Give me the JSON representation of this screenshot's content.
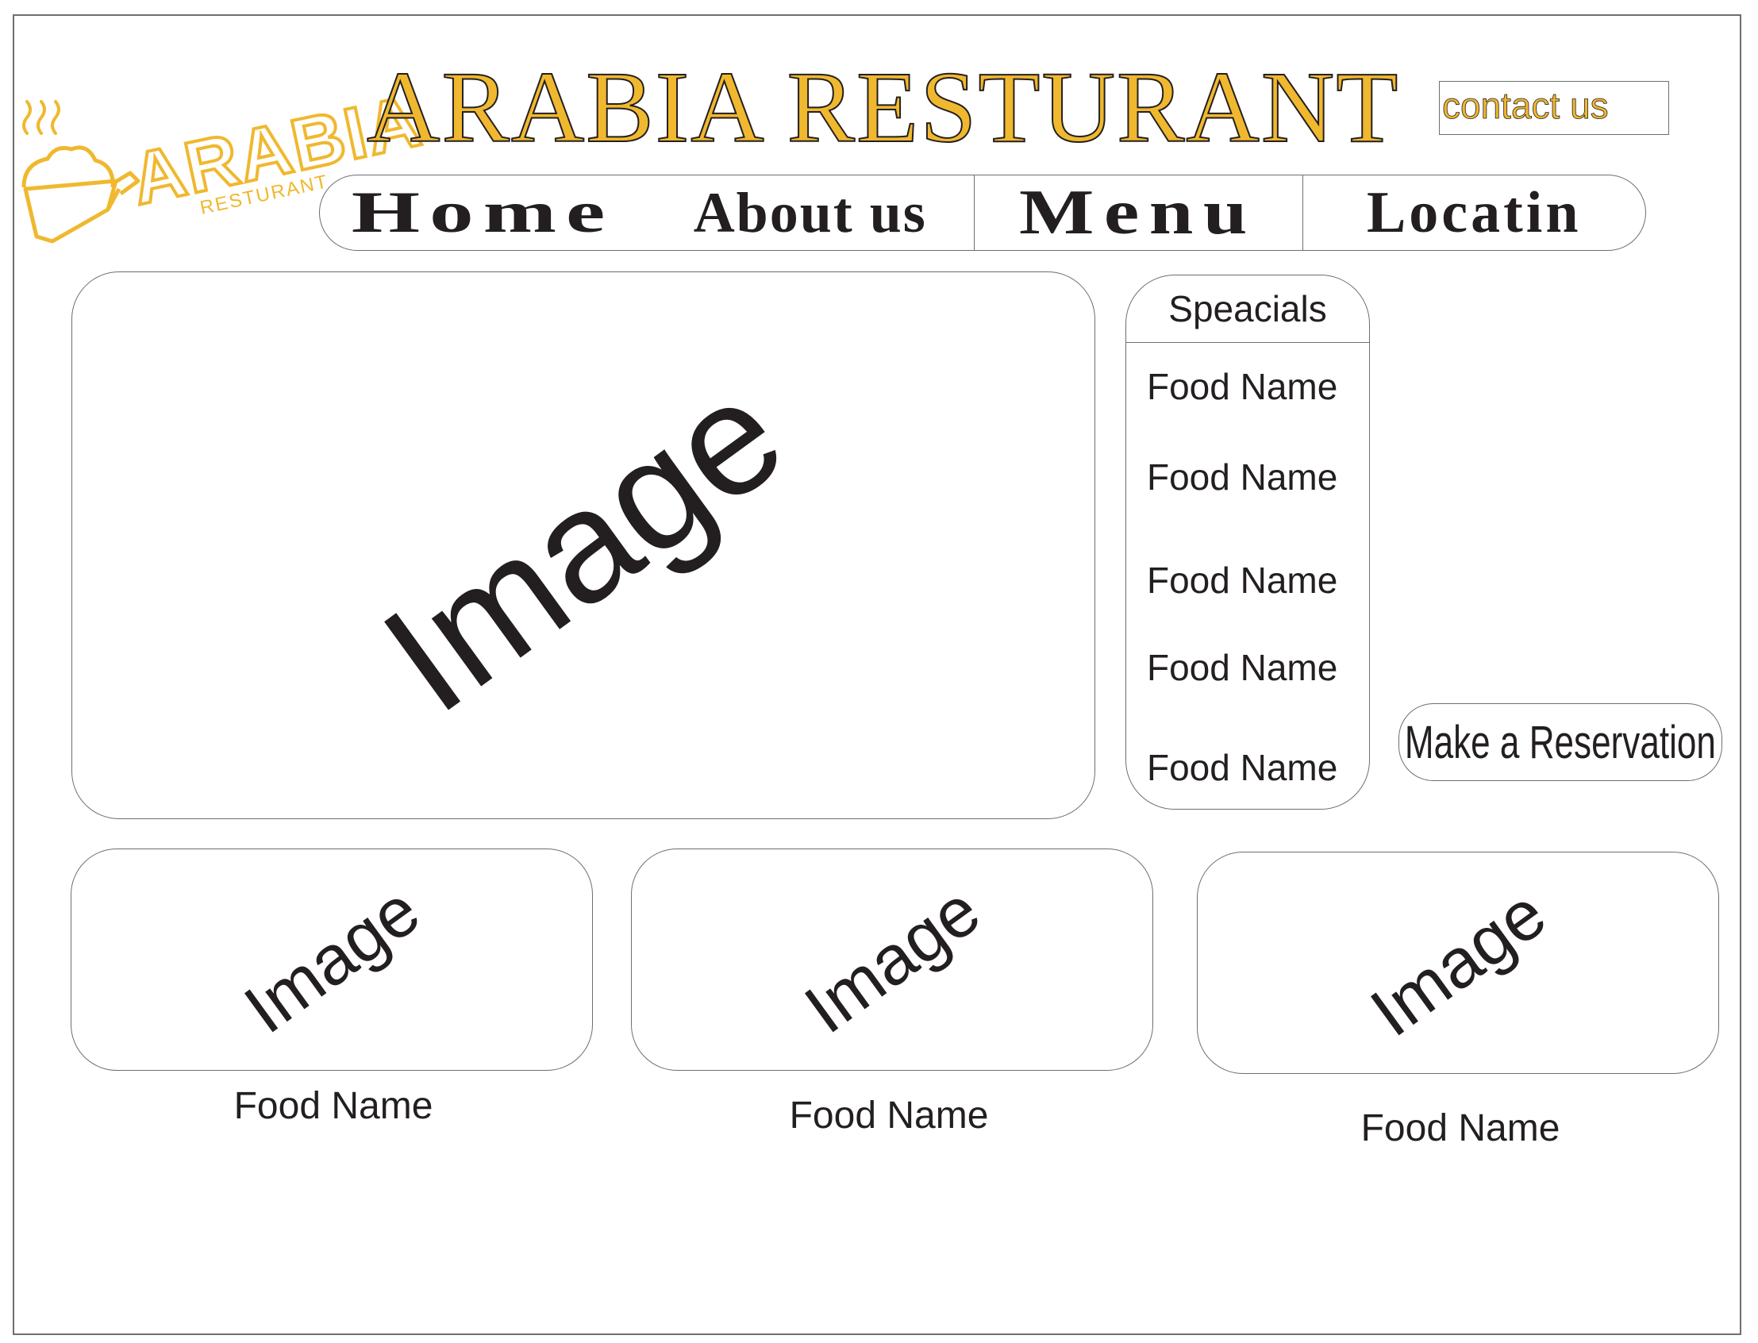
{
  "header": {
    "logo": {
      "word": "ARABIA",
      "subtitle": "RESTURANT",
      "icon": "cooking-pot-icon",
      "color": "#f0b82f"
    },
    "title": "ARABIA RESTURANT",
    "contact_label": "contact us"
  },
  "nav": {
    "items": [
      {
        "label": "Home"
      },
      {
        "label": "About us"
      },
      {
        "label": "Menu"
      },
      {
        "label": "Locatin"
      }
    ]
  },
  "hero": {
    "placeholder": "Image"
  },
  "specials": {
    "title": "Speacials",
    "items": [
      "Food Name",
      "Food Name",
      "Food Name",
      "Food Name",
      "Food Name"
    ]
  },
  "reservation": {
    "label": "Make a Reservation"
  },
  "featured": [
    {
      "placeholder": "Image",
      "caption": "Food Name"
    },
    {
      "placeholder": "Image",
      "caption": "Food Name"
    },
    {
      "placeholder": "Image",
      "caption": "Food Name"
    }
  ],
  "colors": {
    "accent": "#f0b82f",
    "text": "#231f20",
    "border": "#6d6e71"
  }
}
